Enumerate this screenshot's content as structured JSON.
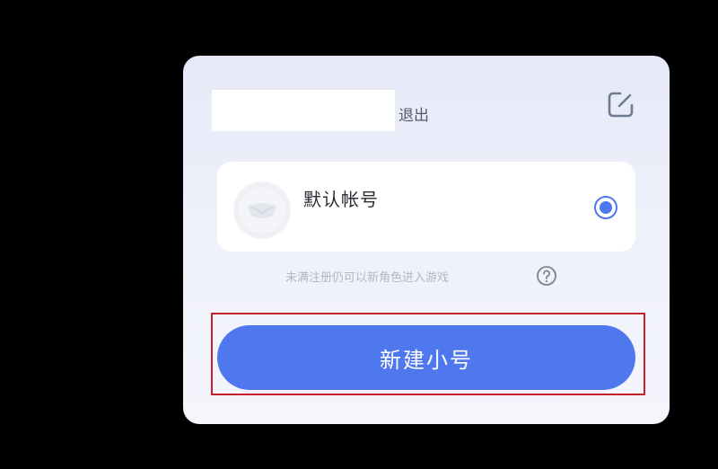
{
  "dialog": {
    "logout_label": "退出",
    "edit_icon": "edit-icon",
    "account": {
      "name": "默认帐号",
      "avatar_icon": "avatar-placeholder",
      "selected": true
    },
    "hint": "未满注册仍可以新角色进入游戏",
    "help_icon": "question-mark-icon",
    "create_button_label": "新建小号"
  },
  "colors": {
    "accent": "#4f77ee",
    "highlight_border": "#c8202a",
    "panel_bg": "#eef0fa",
    "backdrop": "#000000"
  }
}
